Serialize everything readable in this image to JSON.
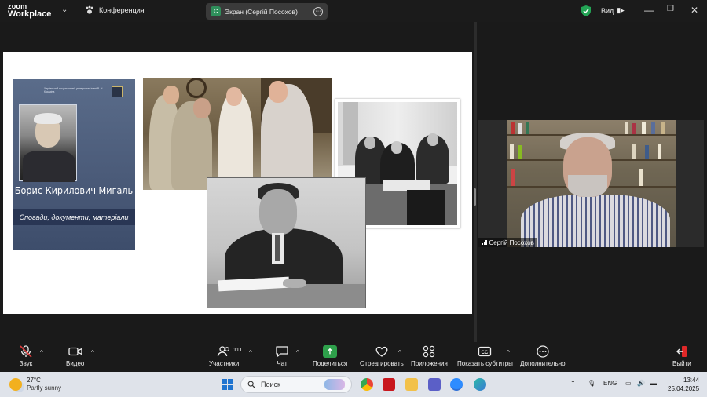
{
  "titlebar": {
    "logo_line1": "zoom",
    "logo_line2": "Workplace",
    "conference_label": "Конференция",
    "screen_badge": "C",
    "screen_title": "Экран (Сергій Посохов)",
    "view_label": "Вид"
  },
  "slide": {
    "book": {
      "header_text": "Харківський національний університет імені В. Н. Каразіна",
      "title": "Борис Кирилович Мигаль",
      "subtitle": "Спогади, документи, матеріали"
    }
  },
  "participant": {
    "name": "Сергій Посохов"
  },
  "toolbar": {
    "items": [
      {
        "label": "Звук",
        "icon": "mic-muted-icon"
      },
      {
        "label": "Видео",
        "icon": "video-camera-icon"
      },
      {
        "label": "Участники",
        "icon": "participants-icon"
      },
      {
        "label": "Чат",
        "icon": "chat-icon"
      },
      {
        "label": "Поделиться",
        "icon": "share-screen-icon"
      },
      {
        "label": "Отреагировать",
        "icon": "heart-icon"
      },
      {
        "label": "Приложения",
        "icon": "apps-icon"
      },
      {
        "label": "Показать субтитры",
        "icon": "cc-icon"
      },
      {
        "label": "Дополнительно",
        "icon": "more-icon"
      },
      {
        "label": "Выйти",
        "icon": "leave-icon"
      }
    ],
    "participants_count": "111",
    "share_color": "#2ea04b",
    "leave_color": "#e02828"
  },
  "taskbar": {
    "temperature": "27°C",
    "weather": "Partly sunny",
    "search_placeholder": "Поиск",
    "language": "ENG",
    "time": "13:44",
    "date": "25.04.2025"
  }
}
